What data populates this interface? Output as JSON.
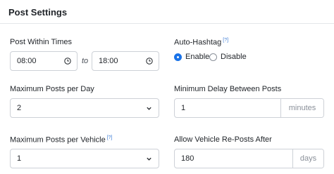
{
  "header": {
    "title": "Post Settings"
  },
  "post_within_times": {
    "label": "Post Within Times",
    "start": "08:00",
    "separator": "to",
    "end": "18:00"
  },
  "auto_hashtag": {
    "label": "Auto-Hashtag",
    "help": "[?]",
    "options": [
      "Enable",
      "Disable"
    ],
    "selected": "Enable"
  },
  "max_posts_day": {
    "label": "Maximum Posts per Day",
    "value": "2"
  },
  "min_delay": {
    "label": "Minimum Delay Between Posts",
    "value": "1",
    "unit": "minutes"
  },
  "max_posts_vehicle": {
    "label": "Maximum Posts per Vehicle",
    "help": "[?]",
    "value": "1"
  },
  "repost_after": {
    "label": "Allow Vehicle Re-Posts After",
    "value": "180",
    "unit": "days"
  },
  "colors": {
    "accent": "#1a73e8",
    "help_link": "#3a7bd5",
    "border": "#cdd1d7"
  },
  "icons": {
    "time": "clock-icon",
    "select": "chevron-down-icon"
  }
}
